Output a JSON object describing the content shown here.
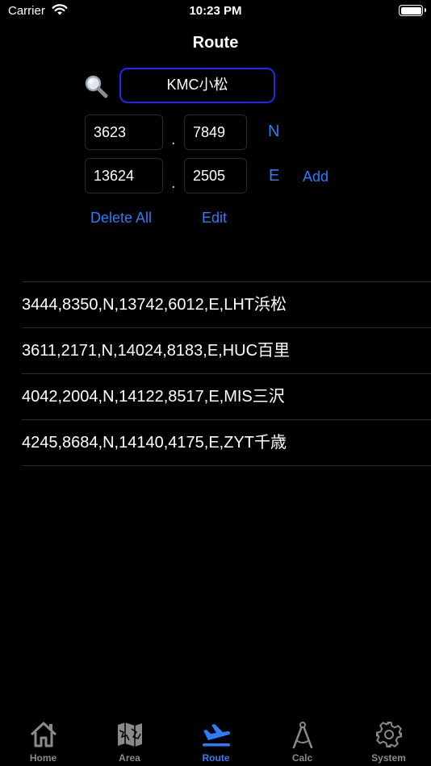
{
  "status_bar": {
    "carrier": "Carrier",
    "time": "10:23 PM"
  },
  "header": {
    "title": "Route"
  },
  "search": {
    "value": "KMC小松"
  },
  "latitude": {
    "deg": "3623",
    "min": "7849",
    "separator": ".",
    "direction": "N"
  },
  "longitude": {
    "deg": "13624",
    "min": "2505",
    "separator": ".",
    "direction": "E"
  },
  "actions": {
    "add": "Add",
    "delete_all": "Delete All",
    "edit": "Edit"
  },
  "route_list": [
    "3444,8350,N,13742,6012,E,LHT浜松",
    "3611,2171,N,14024,8183,E,HUC百里",
    "4042,2004,N,14122,8517,E,MIS三沢",
    "4245,8684,N,14140,4175,E,ZYT千歳"
  ],
  "tabs": [
    {
      "label": "Home",
      "icon": "home-icon"
    },
    {
      "label": "Area",
      "icon": "map-icon"
    },
    {
      "label": "Route",
      "icon": "airplane-icon",
      "active": true
    },
    {
      "label": "Calc",
      "icon": "compass-icon"
    },
    {
      "label": "System",
      "icon": "gear-icon"
    }
  ],
  "colors": {
    "accent": "#2f7cf6",
    "search_border": "#2426f0",
    "inactive": "#8a8a8a"
  }
}
